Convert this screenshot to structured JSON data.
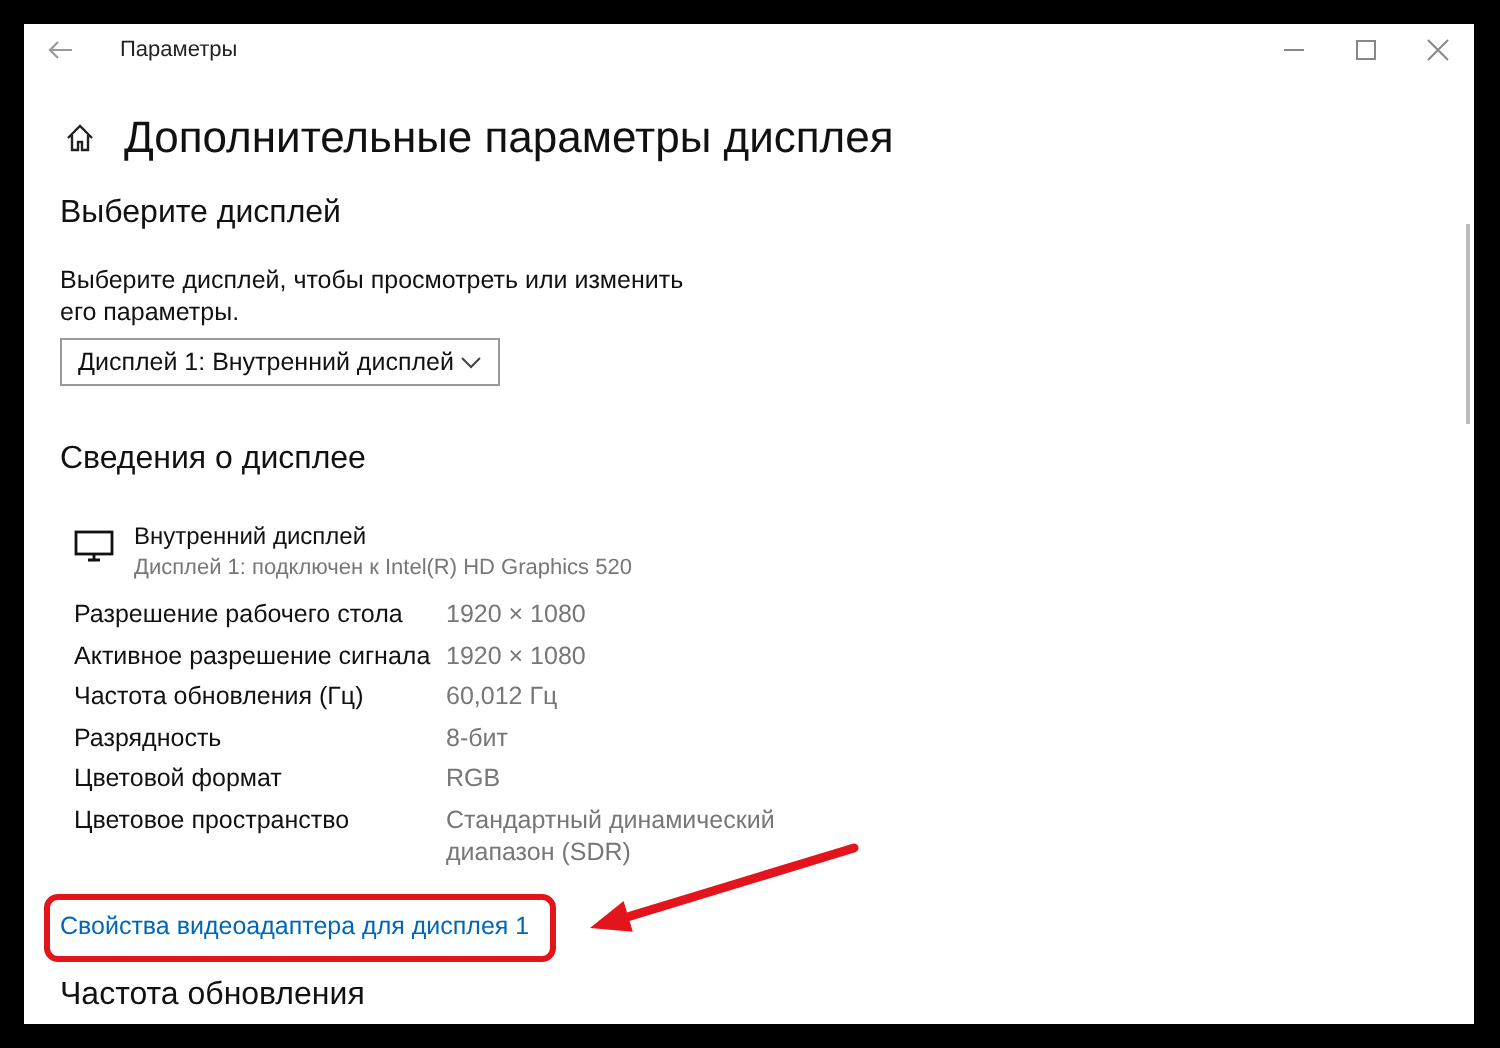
{
  "window": {
    "title": "Параметры"
  },
  "page": {
    "title": "Дополнительные параметры дисплея"
  },
  "select_display": {
    "heading": "Выберите дисплей",
    "description": "Выберите дисплей, чтобы просмотреть или изменить его параметры.",
    "dropdown": {
      "value": "Дисплей 1: Внутренний дисплей"
    }
  },
  "display_info": {
    "heading": "Сведения о дисплее",
    "name": "Внутренний дисплей",
    "subtitle": "Дисплей 1: подключен к Intel(R) HD Graphics 520",
    "rows": [
      {
        "label": "Разрешение рабочего стола",
        "value": "1920 × 1080"
      },
      {
        "label": "Активное разрешение сигнала",
        "value": "1920 × 1080"
      },
      {
        "label": "Частота обновления (Гц)",
        "value": "60,012 Гц"
      },
      {
        "label": "Разрядность",
        "value": "8-бит"
      },
      {
        "label": "Цветовой формат",
        "value": "RGB"
      },
      {
        "label": "Цветовое пространство",
        "value": "Стандартный динамический диапазон (SDR)"
      }
    ],
    "link": "Свойства видеоадаптера для дисплея 1"
  },
  "refresh_rate": {
    "heading": "Частота обновления"
  }
}
